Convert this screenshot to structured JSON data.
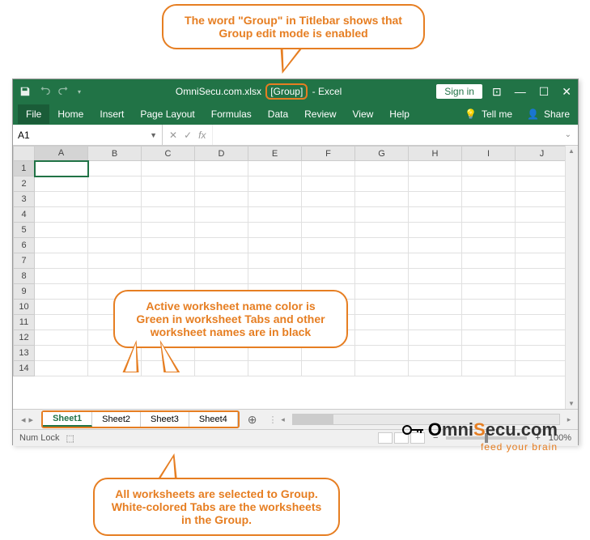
{
  "callouts": {
    "top": "The word \"Group\" in Titlebar shows that Group edit mode is enabled",
    "mid": "Active worksheet name color is Green in worksheet Tabs and other worksheet names are in black",
    "bottom": "All worksheets are selected to Group. White-colored Tabs are the worksheets in the Group."
  },
  "titlebar": {
    "filename": "OmniSecu.com.xlsx",
    "group_marker": "[Group]",
    "app": " - Excel",
    "signin": "Sign in"
  },
  "ribbon": {
    "file": "File",
    "home": "Home",
    "insert": "Insert",
    "pagelayout": "Page Layout",
    "formulas": "Formulas",
    "data": "Data",
    "review": "Review",
    "view": "View",
    "help": "Help",
    "tellme": "Tell me",
    "share": "Share"
  },
  "namebox": "A1",
  "columns": [
    "A",
    "B",
    "C",
    "D",
    "E",
    "F",
    "G",
    "H",
    "I",
    "J"
  ],
  "rows": [
    "1",
    "2",
    "3",
    "4",
    "5",
    "6",
    "7",
    "8",
    "9",
    "10",
    "11",
    "12",
    "13",
    "14"
  ],
  "sheets": {
    "s1": "Sheet1",
    "s2": "Sheet2",
    "s3": "Sheet3",
    "s4": "Sheet4"
  },
  "statusbar": {
    "numlock": "Num Lock",
    "zoom": "100%"
  },
  "watermark": {
    "brand_o": "O",
    "brand_mni": "mni",
    "brand_s": "S",
    "brand_rest": "ecu.com",
    "tag": "feed your brain"
  }
}
